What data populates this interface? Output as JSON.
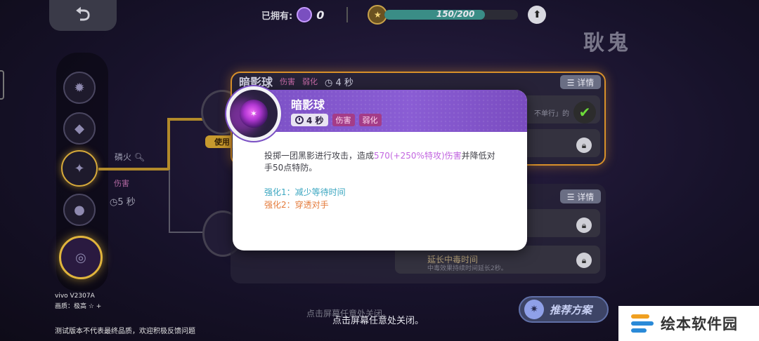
{
  "topbar": {
    "owned_label": "已拥有:",
    "owned_count": "0",
    "xp_text": "150/200",
    "xp_progress": 0.75,
    "upgrade_glyph": "⬆"
  },
  "pokemon_name": "耿鬼",
  "skill_tree": {
    "node_label": "磷火",
    "node_tag": "伤害",
    "node_time": "5 秒",
    "use_tag": "使用"
  },
  "background_panel": {
    "title": "暗影球",
    "tag1": "伤害",
    "tag2": "弱化",
    "time": "4 秒",
    "detail_label": "☰ 详情",
    "row1_text": "不单行」的",
    "detail_label_2": "☰ 详情",
    "row_b_title": "延长中毒时间",
    "row_b_sub": "中毒效果持续时间延长2秒。"
  },
  "popup": {
    "title": "暗影球",
    "time": "4 秒",
    "tag_damage": "伤害",
    "tag_weaken": "弱化",
    "desc_part1": "投掷一团黑影进行攻击，造成",
    "desc_highlight": "570(+250%特攻)伤害",
    "desc_part2": "并降低对手50点特防。",
    "enhance1": "强化1：减少等待时间",
    "enhance2": "强化2：穿透对手"
  },
  "recommend_label": "推荐方案",
  "close_hint": "点击屏幕任意处关闭。",
  "close_hint_ghost": "点击屏幕任意处关闭。",
  "device_model": "vivo V2307A",
  "device_quality": "画质：极高 ☆ +",
  "test_notice": "测试版本不代表最终品质，欢迎积极反馈问题",
  "watermark": "绘本软件园",
  "colors": {
    "popup_header": "#7a4fc4",
    "highlight": "#c266e0",
    "enhance1": "#3aa6c0",
    "enhance2": "#e47a3a",
    "tag_bg": "#a43c88"
  }
}
